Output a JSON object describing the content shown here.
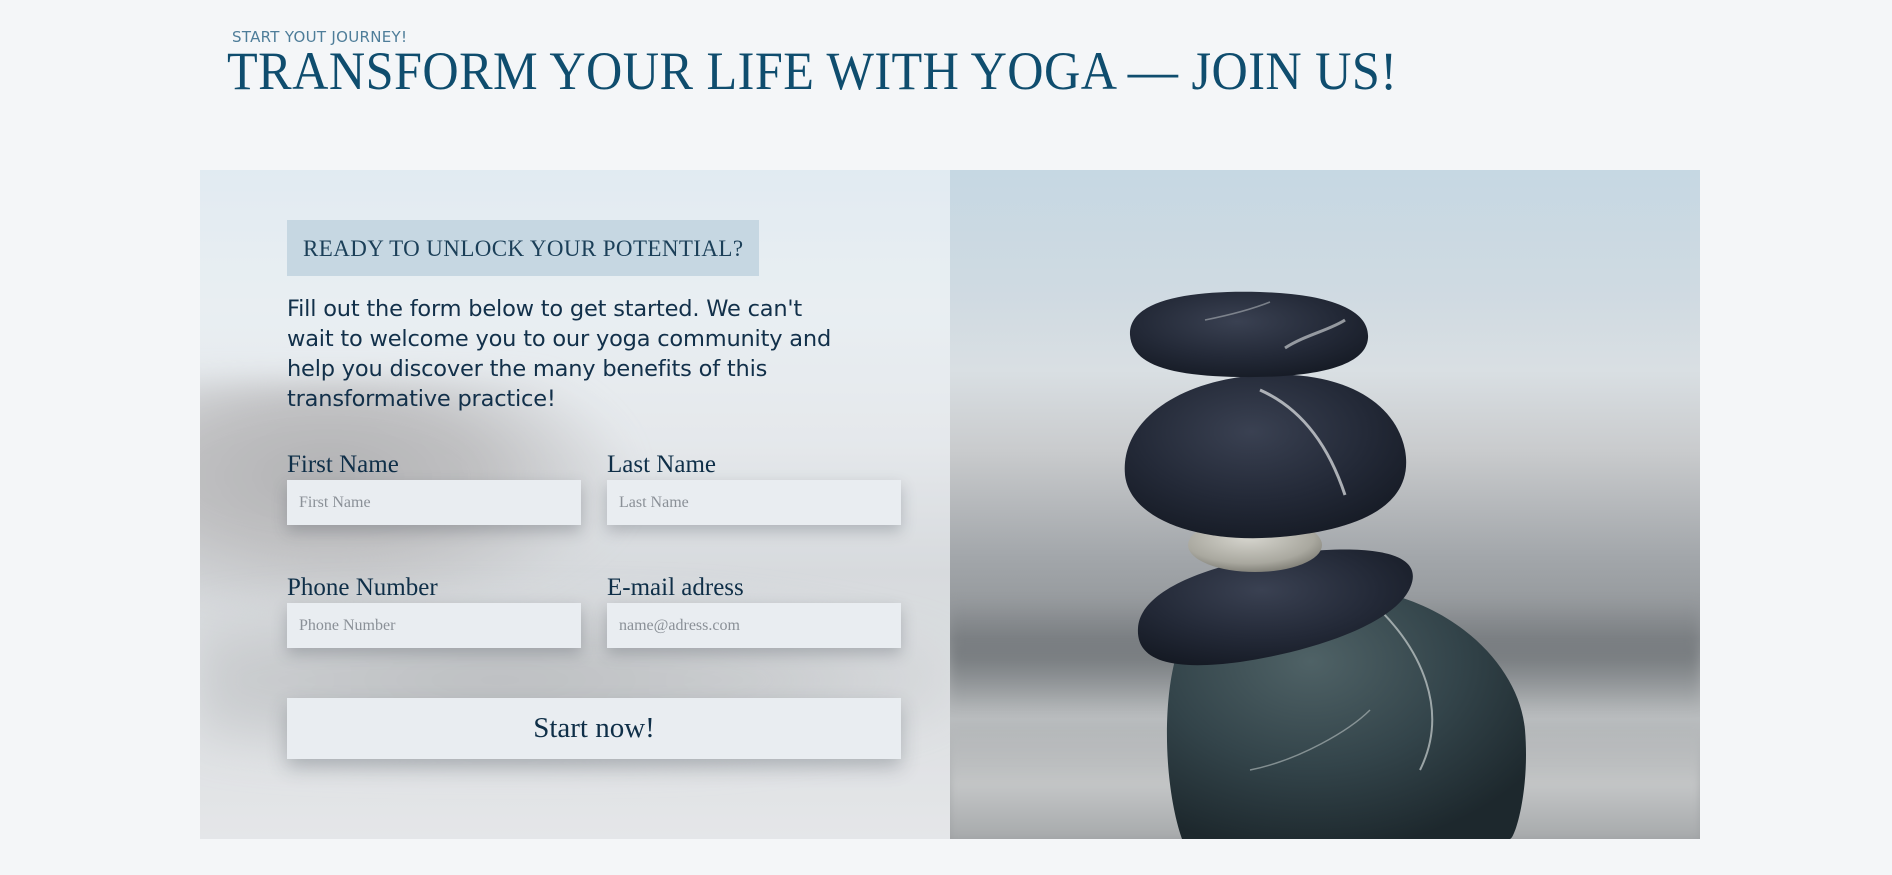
{
  "header": {
    "eyebrow": "START YOUT JOURNEY!",
    "title": "TRANSFORM YOUR LIFE WITH YOGA — JOIN US!"
  },
  "form": {
    "tagline": "READY TO UNLOCK YOUR POTENTIAL?",
    "intro": "Fill out the form below to get started. We can't wait to welcome you to our yoga community and help you discover the many benefits of this transformative practice!",
    "first_name": {
      "label": "First Name",
      "placeholder": "First Name"
    },
    "last_name": {
      "label": "Last Name",
      "placeholder": "Last Name"
    },
    "phone": {
      "label": "Phone Number",
      "placeholder": "Phone Number"
    },
    "email": {
      "label": "E-mail adress",
      "placeholder": "name@adress.com"
    },
    "submit_label": "Start now!"
  },
  "colors": {
    "page_background": "#f4f6f8",
    "title": "#0f4d6e",
    "eyebrow": "#4e7d99",
    "tagline_background": "#c6d7e2",
    "input_background": "#e9edf1"
  }
}
